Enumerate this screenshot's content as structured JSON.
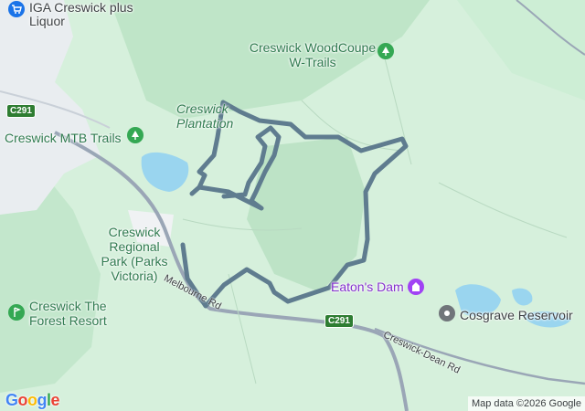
{
  "map": {
    "labels": {
      "iga": "IGA Creswick plus Liquor",
      "woodcoupe": "Creswick WoodCoupe W-Trails",
      "plantation": "Creswick Plantation",
      "mtb": "Creswick MTB Trails",
      "regional_park": "Creswick Regional Park (Parks Victoria)",
      "forest_resort": "Creswick The Forest Resort",
      "eatons_dam": "Eaton's Dam",
      "cosgrave": "Cosgrave Reservoir",
      "melbourne_rd": "Melbourne Rd",
      "creswick_dean_rd": "Creswick-Dean Rd"
    },
    "shields": {
      "c291_top": "C291",
      "c291_bottom": "C291"
    },
    "icons": {
      "iga": "shopping-cart-icon",
      "woodcoupe": "park-tree-icon",
      "mtb": "park-tree-icon",
      "forest_resort": "golf-icon",
      "eatons_dam": "attraction-icon",
      "cosgrave": "place-icon"
    },
    "colors": {
      "route": "#5f7c8f",
      "park": "#d6f0dc",
      "forest": "#bfe5c8",
      "water": "#9ad5ef",
      "road": "#9aa6b6",
      "town": "#eceff1",
      "green_label": "#2f7a4f",
      "purple_label": "#8430ce"
    }
  },
  "branding": {
    "logo": "Google"
  },
  "attribution": "Map data ©2026 Google"
}
